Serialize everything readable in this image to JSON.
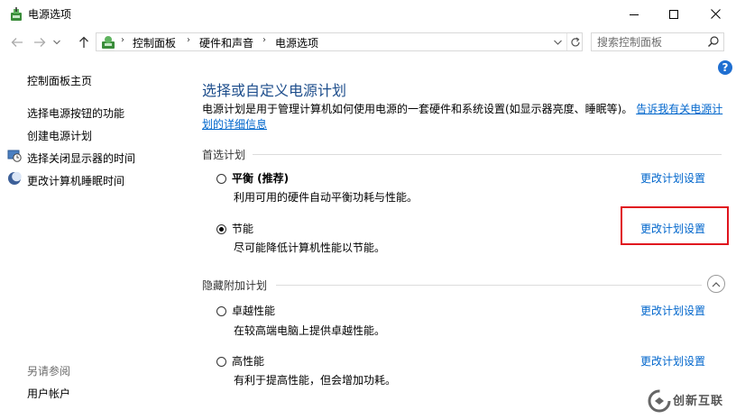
{
  "window": {
    "title": "电源选项"
  },
  "address": {
    "crumbs": [
      "控制面板",
      "硬件和声音",
      "电源选项"
    ],
    "search_placeholder": "搜索控制面板"
  },
  "sidebar": {
    "home": "控制面板主页",
    "links": [
      "选择电源按钮的功能",
      "创建电源计划",
      "选择关闭显示器的时间",
      "更改计算机睡眠时间"
    ],
    "see_also_title": "另请参阅",
    "see_also": [
      "用户帐户"
    ]
  },
  "main": {
    "title": "选择或自定义电源计划",
    "desc_text": "电源计划是用于管理计算机如何使用电源的一套硬件和系统设置(如显示器亮度、睡眠等)。",
    "desc_link": "告诉我有关电源计划的详细信息",
    "preferred_section": "首选计划",
    "hidden_section": "隐藏附加计划",
    "change_label": "更改计划设置",
    "plans": [
      {
        "name": "平衡 (推荐)",
        "desc": "利用可用的硬件自动平衡功耗与性能。",
        "selected": false
      },
      {
        "name": "节能",
        "desc": "尽可能降低计算机性能以节能。",
        "selected": true
      }
    ],
    "hidden_plans": [
      {
        "name": "卓越性能",
        "desc": "在较高端电脑上提供卓越性能。",
        "selected": false
      },
      {
        "name": "高性能",
        "desc": "有利于提高性能，但会增加功耗。",
        "selected": false
      }
    ]
  },
  "watermark": {
    "text": "创新互联"
  },
  "colors": {
    "link": "#0066cc",
    "title": "#1e4e8c",
    "highlight": "#e0141e",
    "help": "#1f6fd1"
  }
}
